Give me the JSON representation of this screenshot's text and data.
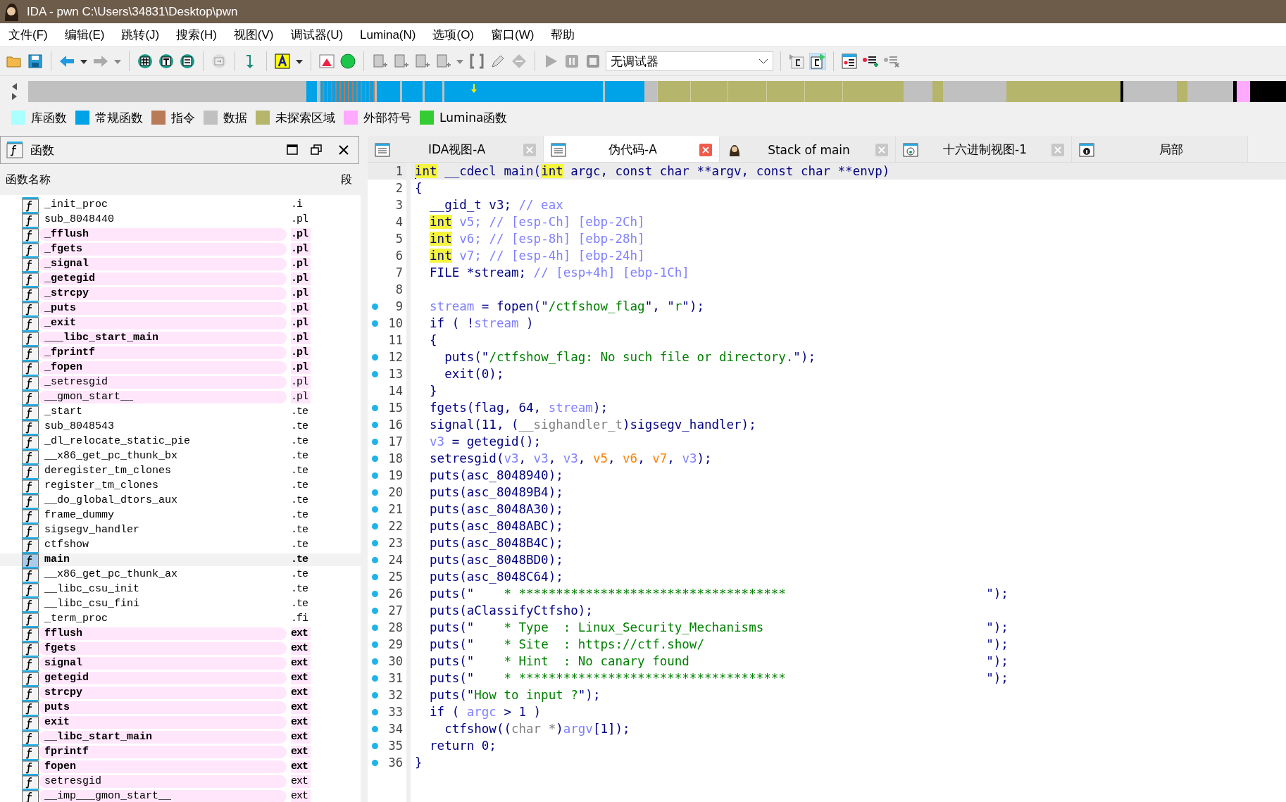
{
  "window": {
    "title": "IDA - pwn C:\\Users\\34831\\Desktop\\pwn"
  },
  "menu": [
    "文件(F)",
    "编辑(E)",
    "跳转(J)",
    "搜索(H)",
    "视图(V)",
    "调试器(U)",
    "Lumina(N)",
    "选项(O)",
    "窗口(W)",
    "帮助"
  ],
  "toolbar": {
    "debugger_select": "无调试器"
  },
  "legend": [
    {
      "label": "库函数",
      "color": "#aaffff"
    },
    {
      "label": "常规函数",
      "color": "#00a2e8"
    },
    {
      "label": "指令",
      "color": "#b97a57"
    },
    {
      "label": "数据",
      "color": "#c0c0c0"
    },
    {
      "label": "未探索区域",
      "color": "#b5b56b"
    },
    {
      "label": "外部符号",
      "color": "#ffaaff"
    },
    {
      "label": "Lumina函数",
      "color": "#33cc33"
    }
  ],
  "functions_panel": {
    "title": "函数",
    "columns": [
      "函数名称",
      "段"
    ],
    "rows": [
      {
        "name": "_init_proc",
        "segment": ".i",
        "kind": "normal",
        "selected": false
      },
      {
        "name": "sub_8048440",
        "segment": ".pl",
        "kind": "normal",
        "selected": false
      },
      {
        "name": "_fflush",
        "segment": ".pl",
        "kind": "import",
        "selected": false
      },
      {
        "name": "_fgets",
        "segment": ".pl",
        "kind": "import",
        "selected": false
      },
      {
        "name": "_signal",
        "segment": ".pl",
        "kind": "import",
        "selected": false
      },
      {
        "name": "_getegid",
        "segment": ".pl",
        "kind": "import",
        "selected": false
      },
      {
        "name": "_strcpy",
        "segment": ".pl",
        "kind": "import",
        "selected": false
      },
      {
        "name": "_puts",
        "segment": ".pl",
        "kind": "import",
        "selected": false
      },
      {
        "name": "_exit",
        "segment": ".pl",
        "kind": "import",
        "selected": false
      },
      {
        "name": "___libc_start_main",
        "segment": ".pl",
        "kind": "import",
        "selected": false
      },
      {
        "name": "_fprintf",
        "segment": ".pl",
        "kind": "import",
        "selected": false
      },
      {
        "name": "_fopen",
        "segment": ".pl",
        "kind": "import",
        "selected": false
      },
      {
        "name": "_setresgid",
        "segment": ".pl",
        "kind": "weak",
        "selected": false
      },
      {
        "name": "__gmon_start__",
        "segment": ".pl",
        "kind": "weak",
        "selected": false
      },
      {
        "name": "_start",
        "segment": ".te",
        "kind": "normal",
        "selected": false
      },
      {
        "name": "sub_8048543",
        "segment": ".te",
        "kind": "normal",
        "selected": false
      },
      {
        "name": "_dl_relocate_static_pie",
        "segment": ".te",
        "kind": "normal",
        "selected": false
      },
      {
        "name": "__x86_get_pc_thunk_bx",
        "segment": ".te",
        "kind": "normal",
        "selected": false
      },
      {
        "name": "deregister_tm_clones",
        "segment": ".te",
        "kind": "normal",
        "selected": false
      },
      {
        "name": "register_tm_clones",
        "segment": ".te",
        "kind": "normal",
        "selected": false
      },
      {
        "name": "__do_global_dtors_aux",
        "segment": ".te",
        "kind": "normal",
        "selected": false
      },
      {
        "name": "frame_dummy",
        "segment": ".te",
        "kind": "normal",
        "selected": false
      },
      {
        "name": "sigsegv_handler",
        "segment": ".te",
        "kind": "normal",
        "selected": false
      },
      {
        "name": "ctfshow",
        "segment": ".te",
        "kind": "normal",
        "selected": false
      },
      {
        "name": "main",
        "segment": ".te",
        "kind": "normal",
        "selected": true
      },
      {
        "name": "__x86_get_pc_thunk_ax",
        "segment": ".te",
        "kind": "normal",
        "selected": false
      },
      {
        "name": "__libc_csu_init",
        "segment": ".te",
        "kind": "normal",
        "selected": false
      },
      {
        "name": "__libc_csu_fini",
        "segment": ".te",
        "kind": "normal",
        "selected": false
      },
      {
        "name": "_term_proc",
        "segment": ".fi",
        "kind": "normal",
        "selected": false
      },
      {
        "name": "fflush",
        "segment": "ext",
        "kind": "import",
        "selected": false
      },
      {
        "name": "fgets",
        "segment": "ext",
        "kind": "import",
        "selected": false
      },
      {
        "name": "signal",
        "segment": "ext",
        "kind": "import",
        "selected": false
      },
      {
        "name": "getegid",
        "segment": "ext",
        "kind": "import",
        "selected": false
      },
      {
        "name": "strcpy",
        "segment": "ext",
        "kind": "import",
        "selected": false
      },
      {
        "name": "puts",
        "segment": "ext",
        "kind": "import",
        "selected": false
      },
      {
        "name": "exit",
        "segment": "ext",
        "kind": "import",
        "selected": false
      },
      {
        "name": "__libc_start_main",
        "segment": "ext",
        "kind": "import",
        "selected": false
      },
      {
        "name": "fprintf",
        "segment": "ext",
        "kind": "import",
        "selected": false
      },
      {
        "name": "fopen",
        "segment": "ext",
        "kind": "import",
        "selected": false
      },
      {
        "name": "setresgid",
        "segment": "ext",
        "kind": "weak",
        "selected": false
      },
      {
        "name": "__imp___gmon_start__",
        "segment": "ext",
        "kind": "weak",
        "selected": false
      }
    ]
  },
  "tabs": [
    {
      "label": "IDA视图-A",
      "kind": "listing",
      "selected": false,
      "closable": true
    },
    {
      "label": "伪代码-A",
      "kind": "listing",
      "selected": true,
      "closable": true
    },
    {
      "label": "Stack of main",
      "kind": "stack",
      "selected": false,
      "closable": true
    },
    {
      "label": "十六进制视图-1",
      "kind": "hex",
      "selected": false,
      "closable": true
    },
    {
      "label": "局部",
      "kind": "info",
      "selected": false,
      "closable": false
    }
  ],
  "code": {
    "lines": [
      {
        "number": "1",
        "dot": false,
        "current": true,
        "tokens": [
          {
            "text": "int",
            "kind": "h"
          },
          {
            "text": " __cdecl main(",
            "kind": "n"
          },
          {
            "text": "int",
            "kind": "h"
          },
          {
            "text": " argc, const char **argv, const char **envp)",
            "kind": "n"
          }
        ]
      },
      {
        "number": "2",
        "dot": false,
        "current": false,
        "tokens": [
          {
            "text": "{",
            "kind": "n"
          }
        ]
      },
      {
        "number": "3",
        "dot": false,
        "current": false,
        "tokens": [
          {
            "text": "  __gid_t v3; ",
            "kind": "n"
          },
          {
            "text": "// eax",
            "kind": "c"
          }
        ]
      },
      {
        "number": "4",
        "dot": false,
        "current": false,
        "tokens": [
          {
            "text": "  int",
            "kind": "h"
          },
          {
            "text": " v5; // [esp-Ch] [ebp-2Ch]",
            "kind": "c"
          }
        ]
      },
      {
        "number": "5",
        "dot": false,
        "current": false,
        "tokens": [
          {
            "text": "  int",
            "kind": "h"
          },
          {
            "text": " v6; // [esp-8h] [ebp-28h]",
            "kind": "c"
          }
        ]
      },
      {
        "number": "6",
        "dot": false,
        "current": false,
        "tokens": [
          {
            "text": "  int",
            "kind": "h"
          },
          {
            "text": " v7; // [esp-4h] [ebp-24h]",
            "kind": "c"
          }
        ]
      },
      {
        "number": "7",
        "dot": false,
        "current": false,
        "tokens": [
          {
            "text": "  FILE *stream; ",
            "kind": "n"
          },
          {
            "text": "// [esp+4h] [ebp-1Ch]",
            "kind": "c"
          }
        ]
      },
      {
        "number": "8",
        "dot": false,
        "current": false
      },
      {
        "number": "9",
        "dot": true,
        "current": false,
        "tokens": [
          {
            "text": "  stream",
            "kind": "c"
          },
          {
            "text": " = fopen(\"",
            "kind": "n"
          },
          {
            "text": "/ctfshow_flag",
            "kind": "s"
          },
          {
            "text": "\", \"",
            "kind": "n"
          },
          {
            "text": "r",
            "kind": "s"
          },
          {
            "text": "\");",
            "kind": "n"
          }
        ]
      },
      {
        "number": "10",
        "dot": true,
        "current": false,
        "tokens": [
          {
            "text": "  if ( !",
            "kind": "n"
          },
          {
            "text": "stream",
            "kind": "c"
          },
          {
            "text": " )",
            "kind": "n"
          }
        ]
      },
      {
        "number": "11",
        "dot": false,
        "current": false,
        "tokens": [
          {
            "text": "  {",
            "kind": "n"
          }
        ]
      },
      {
        "number": "12",
        "dot": true,
        "current": false,
        "tokens": [
          {
            "text": "    puts(\"",
            "kind": "n"
          },
          {
            "text": "/ctfshow_flag: No such file or directory.",
            "kind": "s"
          },
          {
            "text": "\");",
            "kind": "n"
          }
        ]
      },
      {
        "number": "13",
        "dot": true,
        "current": false,
        "tokens": [
          {
            "text": "    exit(0);",
            "kind": "n"
          }
        ]
      },
      {
        "number": "14",
        "dot": false,
        "current": false,
        "tokens": [
          {
            "text": "  }",
            "kind": "n"
          }
        ]
      },
      {
        "number": "15",
        "dot": true,
        "current": false,
        "tokens": [
          {
            "text": "  fgets(flag, 64, ",
            "kind": "n"
          },
          {
            "text": "stream",
            "kind": "c"
          },
          {
            "text": ");",
            "kind": "n"
          }
        ]
      },
      {
        "number": "16",
        "dot": true,
        "current": false,
        "tokens": [
          {
            "text": "  signal(11, (",
            "kind": "n"
          },
          {
            "text": "__sighandler_t",
            "kind": "g"
          },
          {
            "text": ")sigsegv_handler);",
            "kind": "n"
          }
        ]
      },
      {
        "number": "17",
        "dot": true,
        "current": false,
        "tokens": [
          {
            "text": "  v3",
            "kind": "c"
          },
          {
            "text": " = getegid();",
            "kind": "n"
          }
        ]
      },
      {
        "number": "18",
        "dot": true,
        "current": false,
        "tokens": [
          {
            "text": "  setresgid(",
            "kind": "n"
          },
          {
            "text": "v3",
            "kind": "c"
          },
          {
            "text": ", ",
            "kind": "n"
          },
          {
            "text": "v3",
            "kind": "c"
          },
          {
            "text": ", ",
            "kind": "n"
          },
          {
            "text": "v3",
            "kind": "c"
          },
          {
            "text": ", ",
            "kind": "n"
          },
          {
            "text": "v5",
            "kind": "o"
          },
          {
            "text": ", ",
            "kind": "n"
          },
          {
            "text": "v6",
            "kind": "o"
          },
          {
            "text": ", ",
            "kind": "n"
          },
          {
            "text": "v7",
            "kind": "o"
          },
          {
            "text": ", ",
            "kind": "n"
          },
          {
            "text": "v3",
            "kind": "c"
          },
          {
            "text": ");",
            "kind": "n"
          }
        ]
      },
      {
        "number": "19",
        "dot": true,
        "current": false,
        "tokens": [
          {
            "text": "  puts(asc_8048940);",
            "kind": "n"
          }
        ]
      },
      {
        "number": "20",
        "dot": true,
        "current": false,
        "tokens": [
          {
            "text": "  puts(asc_80489B4);",
            "kind": "n"
          }
        ]
      },
      {
        "number": "21",
        "dot": true,
        "current": false,
        "tokens": [
          {
            "text": "  puts(asc_8048A30);",
            "kind": "n"
          }
        ]
      },
      {
        "number": "22",
        "dot": true,
        "current": false,
        "tokens": [
          {
            "text": "  puts(asc_8048ABC);",
            "kind": "n"
          }
        ]
      },
      {
        "number": "23",
        "dot": true,
        "current": false,
        "tokens": [
          {
            "text": "  puts(asc_8048B4C);",
            "kind": "n"
          }
        ]
      },
      {
        "number": "24",
        "dot": true,
        "current": false,
        "tokens": [
          {
            "text": "  puts(asc_8048BD0);",
            "kind": "n"
          }
        ]
      },
      {
        "number": "25",
        "dot": true,
        "current": false,
        "tokens": [
          {
            "text": "  puts(asc_8048C64);",
            "kind": "n"
          }
        ]
      },
      {
        "number": "26",
        "dot": true,
        "current": false,
        "tokens": [
          {
            "text": "  puts(\"",
            "kind": "n"
          },
          {
            "text": "    * ************************************                           ",
            "kind": "s"
          },
          {
            "text": "\");",
            "kind": "n"
          }
        ]
      },
      {
        "number": "27",
        "dot": true,
        "current": false,
        "tokens": [
          {
            "text": "  puts(aClassifyCtfsho);",
            "kind": "n"
          }
        ]
      },
      {
        "number": "28",
        "dot": true,
        "current": false,
        "tokens": [
          {
            "text": "  puts(\"",
            "kind": "n"
          },
          {
            "text": "    * Type  : Linux_Security_Mechanisms                              ",
            "kind": "s"
          },
          {
            "text": "\");",
            "kind": "n"
          }
        ]
      },
      {
        "number": "29",
        "dot": true,
        "current": false,
        "tokens": [
          {
            "text": "  puts(\"",
            "kind": "n"
          },
          {
            "text": "    * Site  : https://ctf.show/                                      ",
            "kind": "s"
          },
          {
            "text": "\");",
            "kind": "n"
          }
        ]
      },
      {
        "number": "30",
        "dot": true,
        "current": false,
        "tokens": [
          {
            "text": "  puts(\"",
            "kind": "n"
          },
          {
            "text": "    * Hint  : No canary found                                        ",
            "kind": "s"
          },
          {
            "text": "\");",
            "kind": "n"
          }
        ]
      },
      {
        "number": "31",
        "dot": true,
        "current": false,
        "tokens": [
          {
            "text": "  puts(\"",
            "kind": "n"
          },
          {
            "text": "    * ************************************                           ",
            "kind": "s"
          },
          {
            "text": "\");",
            "kind": "n"
          }
        ]
      },
      {
        "number": "32",
        "dot": true,
        "current": false,
        "tokens": [
          {
            "text": "  puts(\"",
            "kind": "n"
          },
          {
            "text": "How to input ?",
            "kind": "s"
          },
          {
            "text": "\");",
            "kind": "n"
          }
        ]
      },
      {
        "number": "33",
        "dot": true,
        "current": false,
        "tokens": [
          {
            "text": "  if ( ",
            "kind": "n"
          },
          {
            "text": "argc",
            "kind": "c"
          },
          {
            "text": " > 1 )",
            "kind": "n"
          }
        ]
      },
      {
        "number": "34",
        "dot": true,
        "current": false,
        "tokens": [
          {
            "text": "    ctfshow((",
            "kind": "n"
          },
          {
            "text": "char *",
            "kind": "g"
          },
          {
            "text": ")",
            "kind": "n"
          },
          {
            "text": "argv",
            "kind": "c"
          },
          {
            "text": "[1]);",
            "kind": "n"
          }
        ]
      },
      {
        "number": "35",
        "dot": true,
        "current": false,
        "tokens": [
          {
            "text": "  return 0;",
            "kind": "n"
          }
        ]
      },
      {
        "number": "36",
        "dot": true,
        "current": false,
        "tokens": [
          {
            "text": "}",
            "kind": "n"
          }
        ]
      }
    ]
  }
}
